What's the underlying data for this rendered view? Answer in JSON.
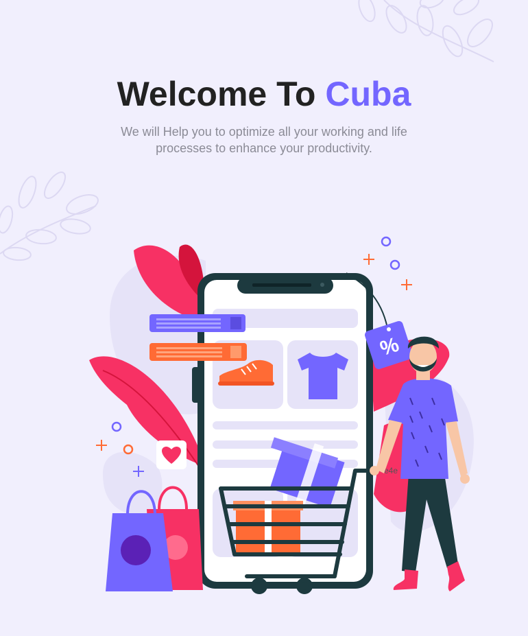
{
  "welcome": {
    "title_prefix": "Welcome To ",
    "title_accent": "Cuba",
    "subtitle": "We will Help you to optimize all your working and life processes to enhance your productivity."
  },
  "illustration": {
    "discount_tag": "%",
    "cart_text": "e4e"
  },
  "colors": {
    "background": "#f1effd",
    "accent": "#7366ff",
    "title": "#222222",
    "subtitle": "#8b8b96",
    "pink": "#f73164",
    "orange": "#ff6b35",
    "dark": "#1d3a3f"
  }
}
